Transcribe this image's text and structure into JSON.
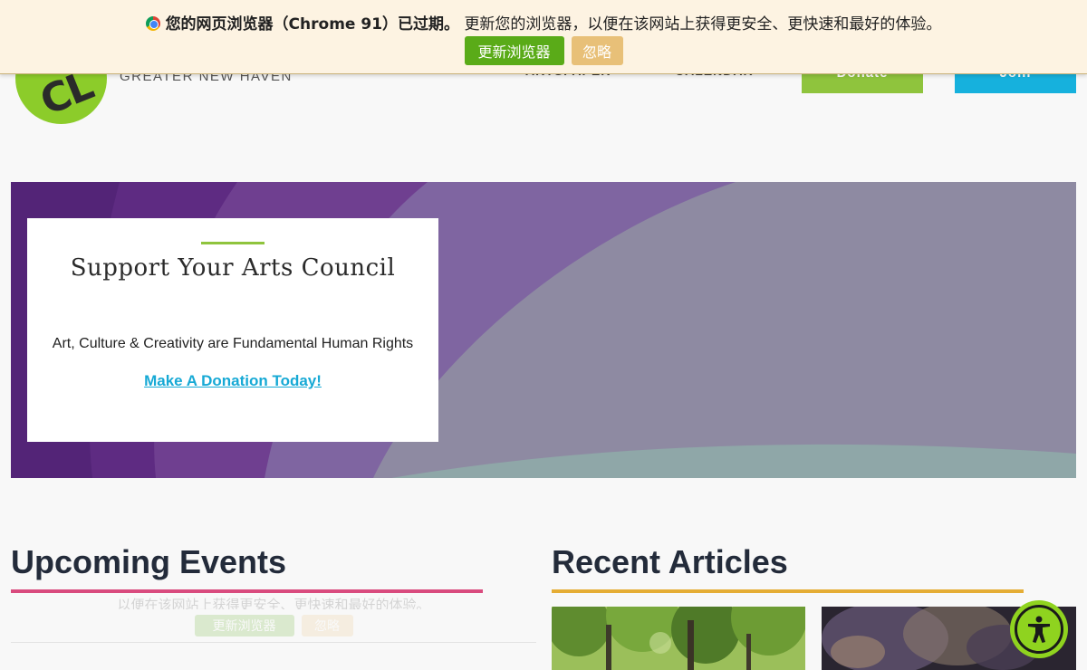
{
  "header": {
    "logo_text": "CL",
    "org_subtitle": "GREATER NEW HAVEN",
    "nav": [
      "ARTSPAPER",
      "CALENDAR"
    ],
    "donate_label": "Donate",
    "join_label": "Join"
  },
  "update_banner": {
    "message_bold": "您的网页浏览器（Chrome 91）已过期。",
    "message_rest": "更新您的浏览器，以便在该网站上获得更安全、更快速和最好的体验。",
    "update_label": "更新浏览器",
    "ignore_label": "忽略"
  },
  "hero": {
    "title": "Support Your Arts Council",
    "subtitle": "Art, Culture & Creativity are Fundamental Human Rights",
    "link_label": "Make A Donation Today!"
  },
  "sections": {
    "events_title": "Upcoming Events",
    "articles_title": "Recent Articles"
  },
  "ghost_banner": {
    "message": "以便在该网站上获得更安全、更快速和最好的体验。",
    "update_label": "更新浏览器",
    "ignore_label": "忽略"
  },
  "colors": {
    "brand_green": "#8fc43d",
    "brand_blue": "#16b1dd",
    "events_accent": "#d94b7e",
    "articles_accent": "#e5ad35",
    "hero_purple": "#5a2a7c"
  },
  "icons": {
    "browser": "chrome-icon",
    "accessibility": "accessibility-icon"
  }
}
